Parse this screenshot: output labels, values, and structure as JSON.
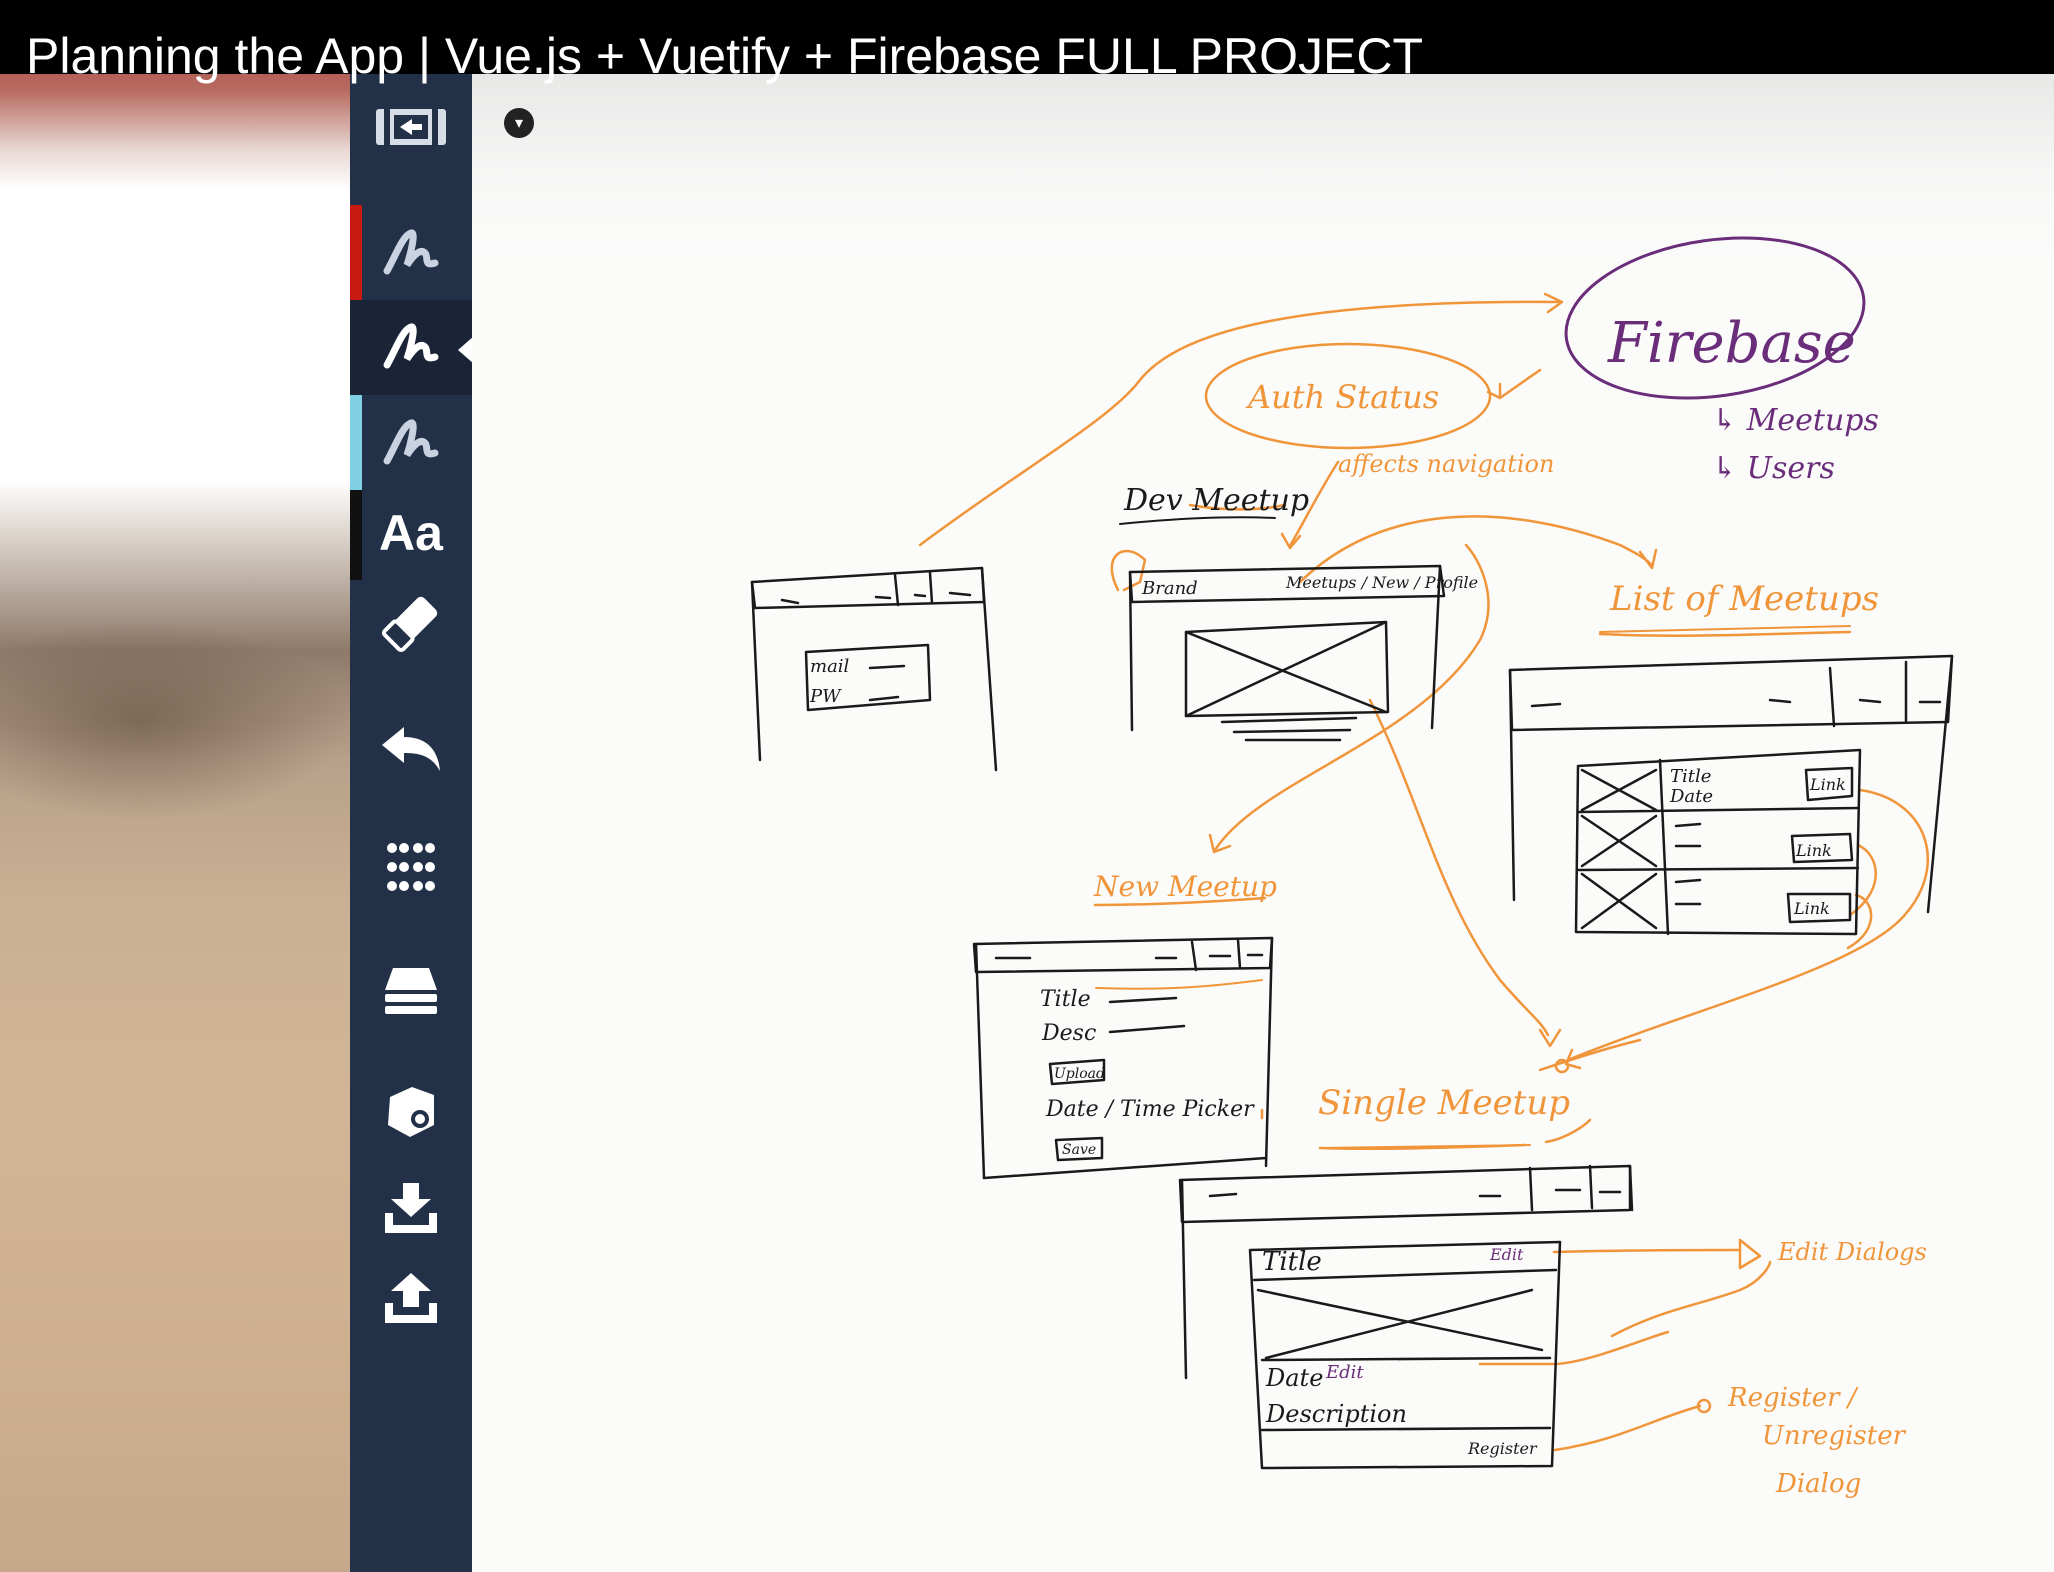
{
  "video": {
    "title": "Planning the App | Vue.js + Vuetify + Firebase FULL PROJECT"
  },
  "colors": {
    "toolbar_bg": "#233148",
    "orange_ink": "#f0953a",
    "purple_ink": "#6a2d7a",
    "black_ink": "#1a1a1a",
    "pen_red": "#c81a12",
    "pen_orange": "#f0811e",
    "pen_blue": "#7fd0e2",
    "pen_black": "#111111"
  },
  "toolbar": {
    "collapse_icon": "panel-collapse-icon",
    "tools": [
      {
        "name": "pen-red",
        "icon": "pen-icon",
        "color": "#c81a12"
      },
      {
        "name": "pen-orange",
        "icon": "pen-icon",
        "color": "#f0811e",
        "active": true
      },
      {
        "name": "pen-blue",
        "icon": "pen-icon",
        "color": "#7fd0e2"
      },
      {
        "name": "text",
        "icon": "text-tool-icon",
        "label": "Aa",
        "color": "#111111"
      },
      {
        "name": "eraser",
        "icon": "eraser-icon"
      },
      {
        "name": "undo",
        "icon": "undo-icon"
      },
      {
        "name": "grid",
        "icon": "grid-icon"
      },
      {
        "name": "layers",
        "icon": "layers-icon"
      },
      {
        "name": "shapes",
        "icon": "shapes-icon"
      },
      {
        "name": "download",
        "icon": "download-icon"
      },
      {
        "name": "upload",
        "icon": "upload-icon"
      }
    ]
  },
  "sketch": {
    "firebase": {
      "title": "Firebase",
      "items": [
        "↳ Meetups",
        "↳ Users"
      ]
    },
    "auth_status": "Auth Status",
    "affects_navigation": "affects navigation",
    "dev_meetup": "Dev Meetup",
    "main_screen": {
      "brand": "Brand",
      "nav": "Meetups / New / Profile"
    },
    "signin_screen": {
      "mail": "mail",
      "pw": "PW"
    },
    "list_of_meetups": "List of Meetups",
    "list_screen": {
      "title": "Title",
      "date": "Date",
      "link_labels": [
        "Link",
        "Link",
        "Link"
      ]
    },
    "new_meetup": "New Meetup",
    "new_screen": {
      "fields": [
        "Title",
        "Desc",
        "Upload",
        "Date / Time Picker",
        "Save"
      ]
    },
    "single_meetup": "Single Meetup",
    "single_screen": {
      "title": "Title",
      "edit": "Edit",
      "date": "Date",
      "date_edit": "Edit",
      "description": "Description",
      "register": "Register"
    },
    "edit_dialog": "Edit Dialogs",
    "register_dialog": [
      "Register /",
      "Unregister",
      "Dialog"
    ]
  }
}
